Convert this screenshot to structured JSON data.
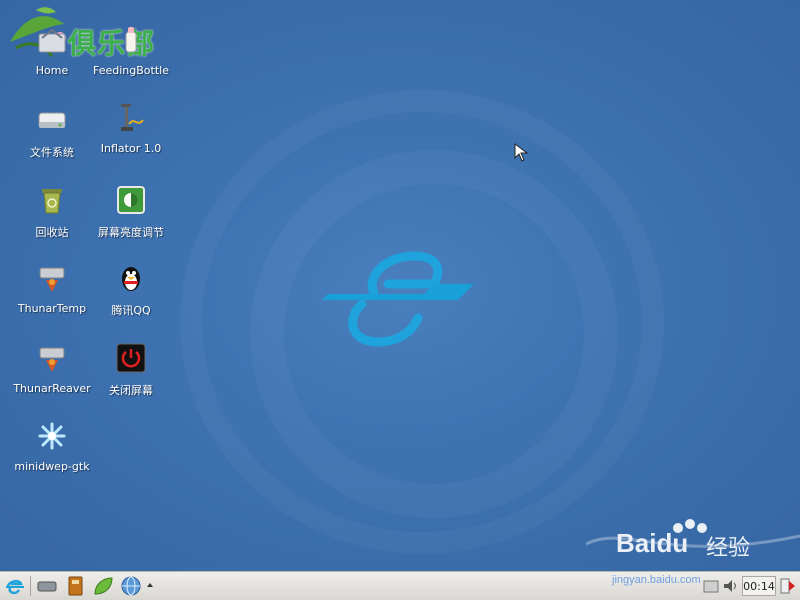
{
  "desktop": {
    "background_color": "#3d70ae",
    "icons": [
      {
        "label": "Home",
        "icon": "home-folder-icon"
      },
      {
        "label": "FeedingBottle",
        "icon": "feedingbottle-app-icon"
      },
      {
        "label": "文件系统",
        "icon": "harddisk-icon"
      },
      {
        "label": "Inflator 1.0",
        "icon": "inflator-pump-icon"
      },
      {
        "label": "回收站",
        "icon": "trash-icon"
      },
      {
        "label": "屏幕亮度调节",
        "icon": "brightness-icon"
      },
      {
        "label": "ThunarTemp",
        "icon": "thunar-drive-icon"
      },
      {
        "label": "腾讯QQ",
        "icon": "qq-penguin-icon"
      },
      {
        "label": "ThunarReaver",
        "icon": "thunar-drive-icon"
      },
      {
        "label": "关闭屏幕",
        "icon": "power-icon"
      },
      {
        "label": "minidwep-gtk",
        "icon": "minidwep-icon"
      }
    ]
  },
  "watermarks": {
    "club_text": "俱乐部",
    "baidu_text": "Baidu",
    "jingyan_text": "经验",
    "url_text": "jingyan.baidu.com"
  },
  "taskbar": {
    "clock": "00:14",
    "launchers": [
      "start-menu-icon",
      "drive-icon",
      "notebook-icon",
      "leaf-icon",
      "browser-globe-icon"
    ],
    "accent_color": "#e7e6e2"
  }
}
